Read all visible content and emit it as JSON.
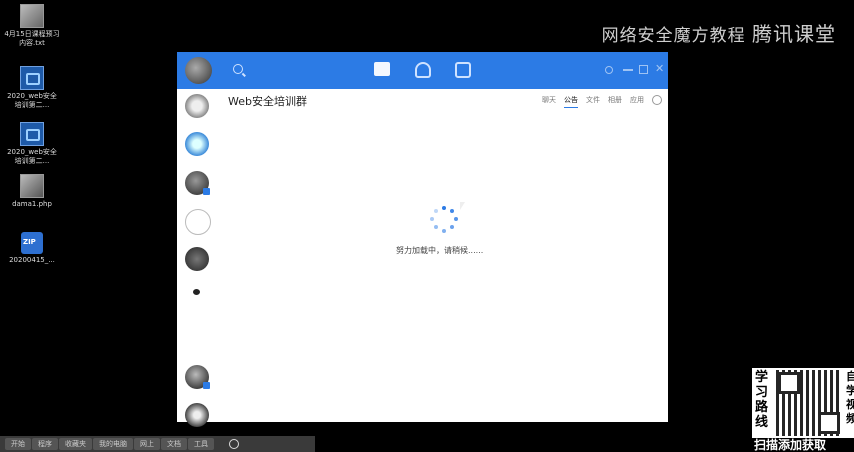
{
  "desktop": {
    "icons": [
      {
        "label": "4月15日课程预习内容.txt",
        "icon": "text-file-icon"
      },
      {
        "label": "2020_web安全培训第二...",
        "icon": "web-course-icon"
      },
      {
        "label": "2020_web安全培训第二...",
        "icon": "web-course-icon"
      },
      {
        "label": "dama1.php",
        "icon": "php-file-icon"
      },
      {
        "label": "20200415_...",
        "icon": "zip-file-icon"
      }
    ]
  },
  "watermark": {
    "text_a": "网络安全魔方教程",
    "text_b": "腾讯课堂"
  },
  "qq": {
    "group_title": "Web安全培训群",
    "tabs": [
      "聊天",
      "公告",
      "文件",
      "相册",
      "应用"
    ],
    "active_tab": "公告",
    "loading_text": "努力加载中，请稍候......"
  },
  "taskbar": {
    "items": [
      "开始",
      "程序",
      "收藏夹",
      "我的电脑",
      "网上",
      "文档",
      "工具"
    ]
  },
  "promo": {
    "left_text": "学习路线",
    "right_text": "自学视频",
    "bottom_text": "扫描添加获取"
  },
  "colors": {
    "accent": "#2c7be5",
    "window_bg": "#ffffff",
    "desktop_bg": "#000000"
  }
}
